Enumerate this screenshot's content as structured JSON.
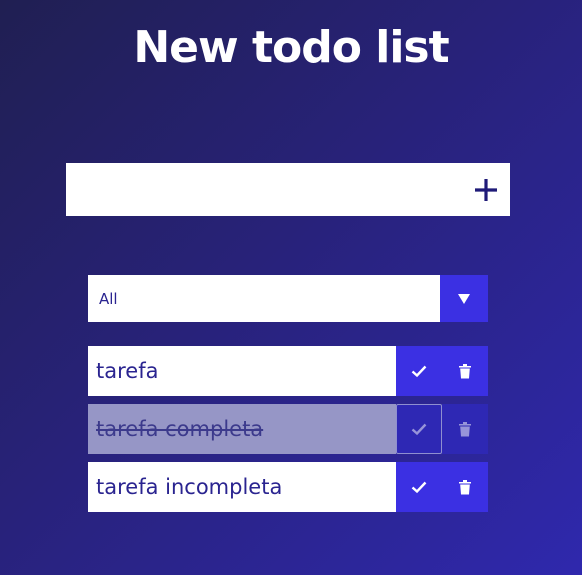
{
  "header": {
    "title": "New todo list"
  },
  "add_form": {
    "input_value": "",
    "placeholder": ""
  },
  "filter": {
    "selected": "All"
  },
  "todos": [
    {
      "label": "tarefa",
      "completed": false
    },
    {
      "label": "tarefa completa",
      "completed": true
    },
    {
      "label": "tarefa incompleta",
      "completed": false
    }
  ],
  "icons": {
    "add": "plus-icon",
    "dropdown": "caret-down-icon",
    "check": "check-icon",
    "delete": "trash-icon"
  },
  "colors": {
    "accent": "#3b30e3",
    "text": "#2a2490",
    "completed_bg": "#9696c6"
  }
}
